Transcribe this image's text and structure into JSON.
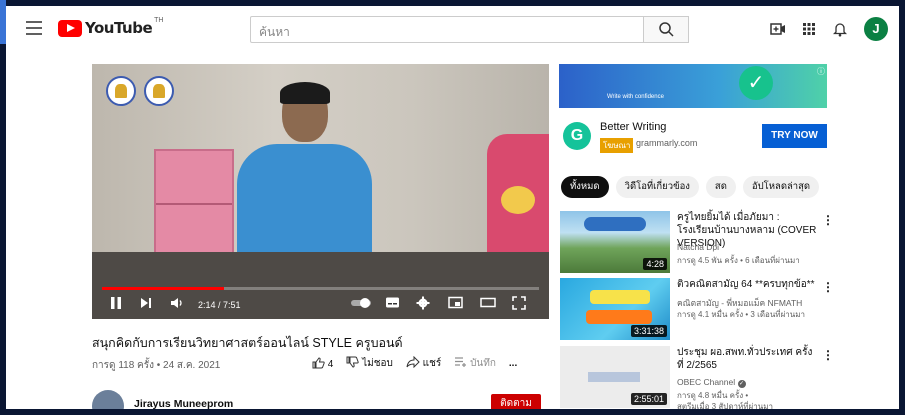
{
  "header": {
    "logo_text": "YouTube",
    "logo_tm": "TH",
    "search_placeholder": "ค้นหา"
  },
  "video": {
    "time": "2:14 / 7:51",
    "progress": 0.28,
    "title": "สนุกคิดกับการเรียนวิทยาศาสตร์ออนไลน์ STYLE ครูบอนด์",
    "meta": "การดู 118 ครั้ง • 24 ส.ค. 2021",
    "likes": "4",
    "dislike_label": "ไม่ชอบ",
    "share_label": "แชร์",
    "save_label": "บันทึก",
    "more": "...",
    "channel": "Jirayus Muneeprom",
    "subscribe": "ติดตาม"
  },
  "ad": {
    "banner_text": "Write with confidence",
    "name": "Better Writing",
    "tag": "โฆษณา",
    "domain": "grammarly.com",
    "cta": "TRY NOW"
  },
  "chips": [
    "ทั้งหมด",
    "วิดีโอที่เกี่ยวข้อง",
    "สด",
    "อัปโหลดล่าสุด"
  ],
  "recs": [
    {
      "title": "ครูไทยยิ้มได้ เมื่อภัยมา : โรงเรียนบ้านบางหลาม (COVER VERSION)",
      "channel": "Natcha Dpi",
      "meta": "การดู 4.5 พัน ครั้ง • 6 เดือนที่ผ่านมา",
      "duration": "4:28"
    },
    {
      "title": "ติวคณิตสามัญ 64 **ครบทุกข้อ**",
      "channel": "คณิตสามัญ - พี่หมอแม็ค NFMATH",
      "meta": "การดู 4.1 หมื่น ครั้ง • 3 เดือนที่ผ่านมา",
      "duration": "3:31:38"
    },
    {
      "title": "ประชุม ผอ.สพท.ทั่วประเทศ ครั้งที่ 2/2565",
      "channel": "OBEC Channel",
      "meta": "การดู 4.8 หมื่น ครั้ง •",
      "meta2": "สตรีมเมื่อ 3 สัปดาห์ที่ผ่านมา",
      "duration": "2:55:01"
    }
  ]
}
